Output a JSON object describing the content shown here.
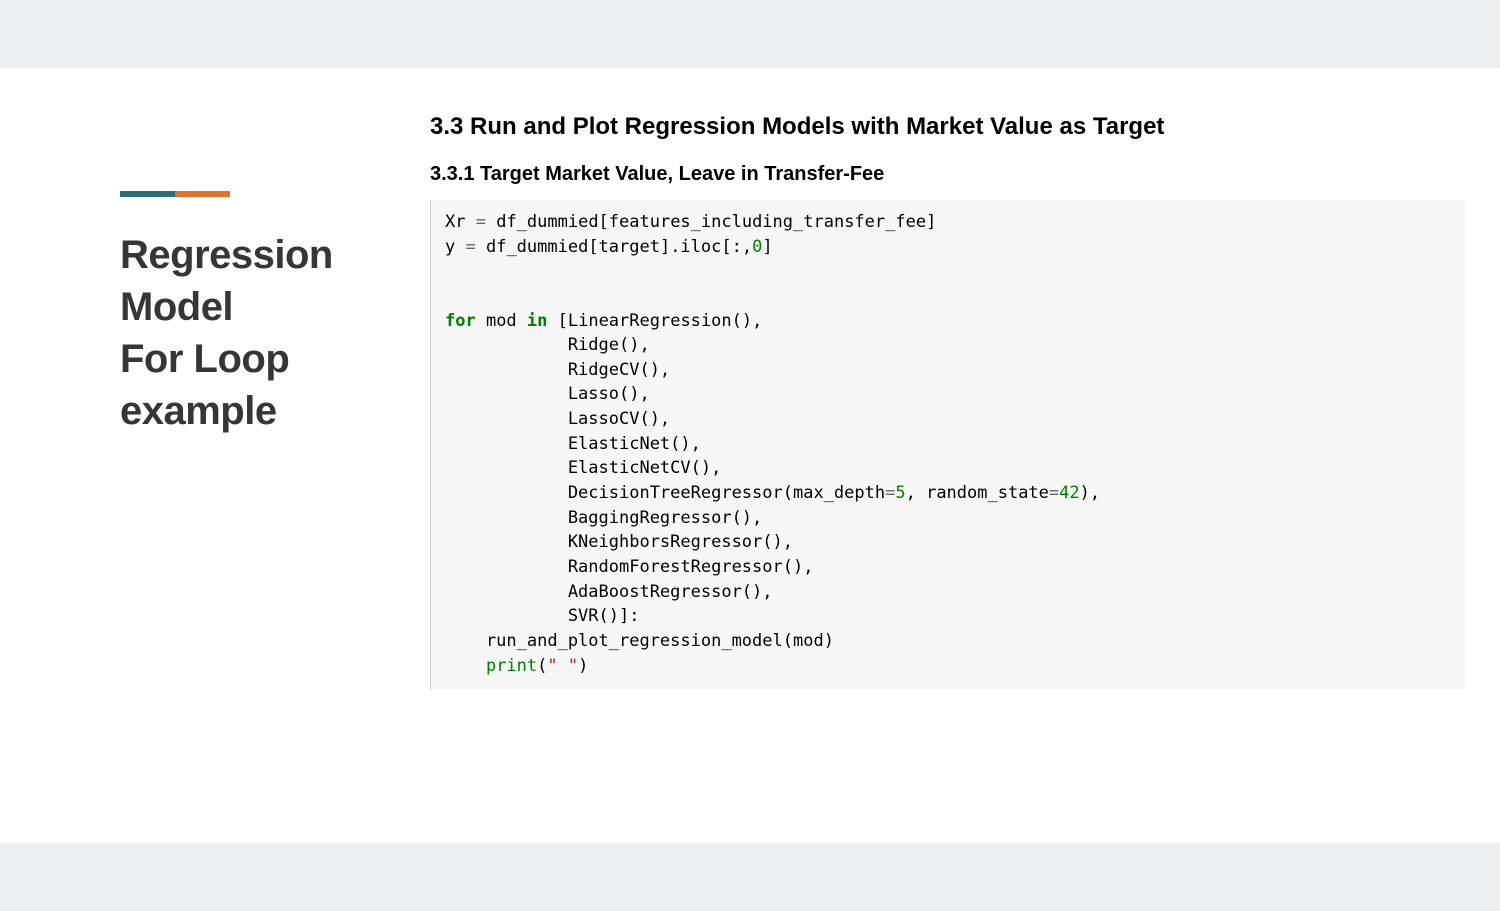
{
  "sidebar": {
    "title_line1": "Regression",
    "title_line2": "Model",
    "title_line3": "For Loop",
    "title_line4": "example"
  },
  "main": {
    "section_heading": "3.3  Run and Plot Regression Models with Market Value as Target",
    "subsection_heading": "3.3.1  Target Market Value, Leave in Transfer-Fee"
  },
  "code": {
    "l01a": "Xr ",
    "l01b": "=",
    "l01c": " df_dummied[features_including_transfer_fee]",
    "l02a": "y ",
    "l02b": "=",
    "l02c": " df_dummied[target].iloc[:,",
    "l02d": "0",
    "l02e": "]",
    "blank": "",
    "l04a": "for",
    "l04b": " mod ",
    "l04c": "in",
    "l04d": " [LinearRegression(),",
    "l05": "            Ridge(),",
    "l06": "            RidgeCV(),",
    "l07": "            Lasso(),",
    "l08": "            LassoCV(),",
    "l09": "            ElasticNet(),",
    "l10": "            ElasticNetCV(),",
    "l11a": "            DecisionTreeRegressor(max_depth",
    "l11b": "=",
    "l11c": "5",
    "l11d": ", random_state",
    "l11e": "=",
    "l11f": "42",
    "l11g": "),",
    "l12": "            BaggingRegressor(),",
    "l13": "            KNeighborsRegressor(),",
    "l14": "            RandomForestRegressor(),",
    "l15": "            AdaBoostRegressor(),",
    "l16": "            SVR()]:",
    "l17": "    run_and_plot_regression_model(mod)",
    "l18a": "    ",
    "l18b": "print",
    "l18c": "(",
    "l18d": "\" \"",
    "l18e": ")"
  }
}
